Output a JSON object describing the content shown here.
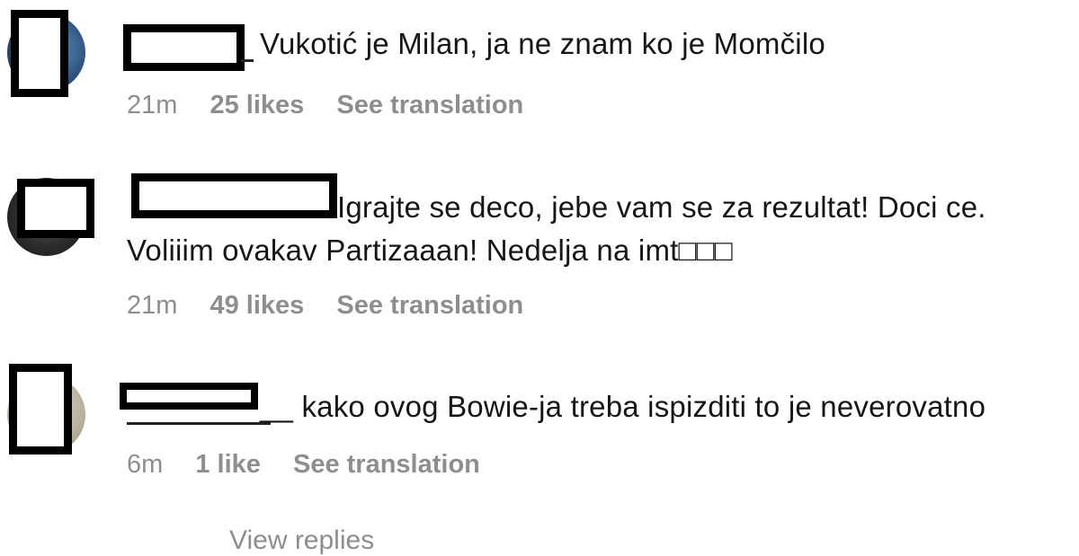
{
  "comments": [
    {
      "text": "Vukotić je Milan, ja ne znam ko je Momčilo",
      "time": "21m",
      "likes": "25 likes",
      "translate": "See translation"
    },
    {
      "text_line1": "Igrajte se deco, jebe vam se za rezultat! Doci ce.",
      "text_line2": "Voliiim ovakav Partizaaan! Nedelja na imt□□□",
      "time": "21m",
      "likes": "49 likes",
      "translate": "See translation"
    },
    {
      "text": "__ kako ovog Bowie-ja treba ispizditi to je neverovatno",
      "time": "6m",
      "likes": "1 like",
      "translate": "See translation"
    }
  ],
  "footer": {
    "view_more": "View replies"
  },
  "colors": {
    "text": "#161616",
    "meta": "#8e8e8e",
    "redaction": "#000000"
  }
}
